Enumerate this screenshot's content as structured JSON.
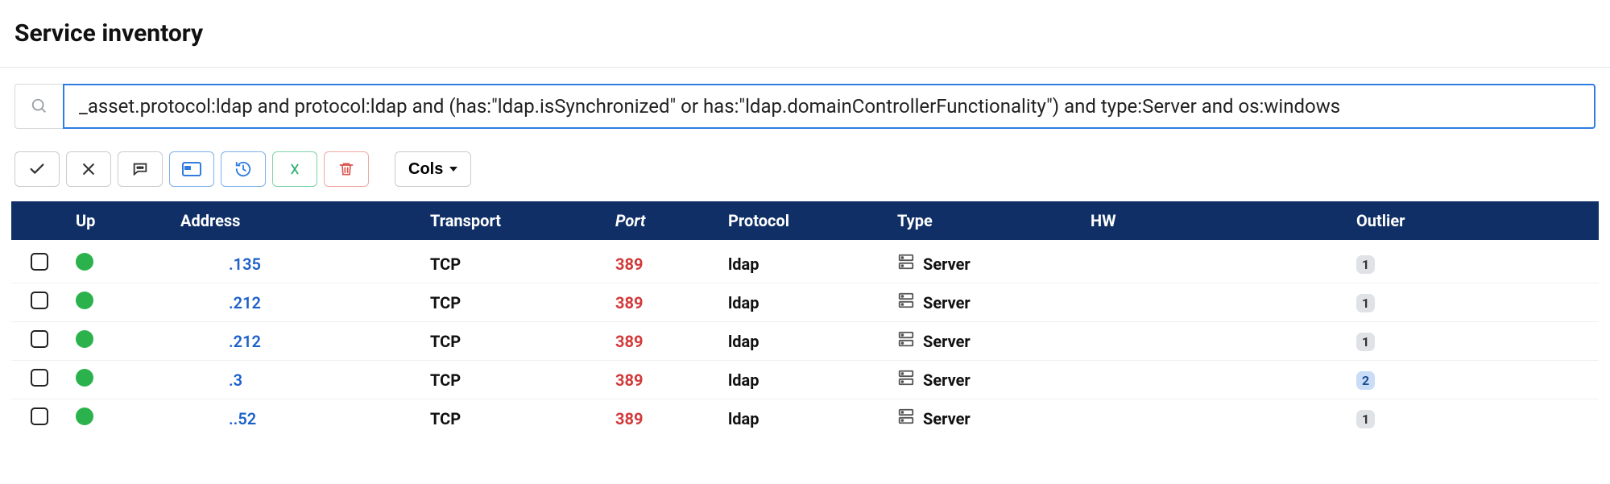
{
  "header": {
    "title": "Service inventory"
  },
  "search": {
    "value": "_asset.protocol:ldap and protocol:ldap and (has:\"ldap.isSynchronized\" or has:\"ldap.domainControllerFunctionality\") and type:Server and os:windows"
  },
  "toolbar": {
    "cols_label": "Cols"
  },
  "table": {
    "columns": {
      "up": "Up",
      "address": "Address",
      "transport": "Transport",
      "port": "Port",
      "protocol": "Protocol",
      "type": "Type",
      "hw": "HW",
      "outlier": "Outlier"
    },
    "rows": [
      {
        "up": true,
        "address": ".135",
        "transport": "TCP",
        "port": "389",
        "protocol": "ldap",
        "type": "Server",
        "hw": "",
        "outlier": "1",
        "outlier_style": "grey"
      },
      {
        "up": true,
        "address": ".212",
        "transport": "TCP",
        "port": "389",
        "protocol": "ldap",
        "type": "Server",
        "hw": "",
        "outlier": "1",
        "outlier_style": "grey"
      },
      {
        "up": true,
        "address": ".212",
        "transport": "TCP",
        "port": "389",
        "protocol": "ldap",
        "type": "Server",
        "hw": "",
        "outlier": "1",
        "outlier_style": "grey"
      },
      {
        "up": true,
        "address": ".3",
        "transport": "TCP",
        "port": "389",
        "protocol": "ldap",
        "type": "Server",
        "hw": "",
        "outlier": "2",
        "outlier_style": "blue"
      },
      {
        "up": true,
        "address": "..52",
        "transport": "TCP",
        "port": "389",
        "protocol": "ldap",
        "type": "Server",
        "hw": "",
        "outlier": "1",
        "outlier_style": "grey"
      }
    ]
  }
}
